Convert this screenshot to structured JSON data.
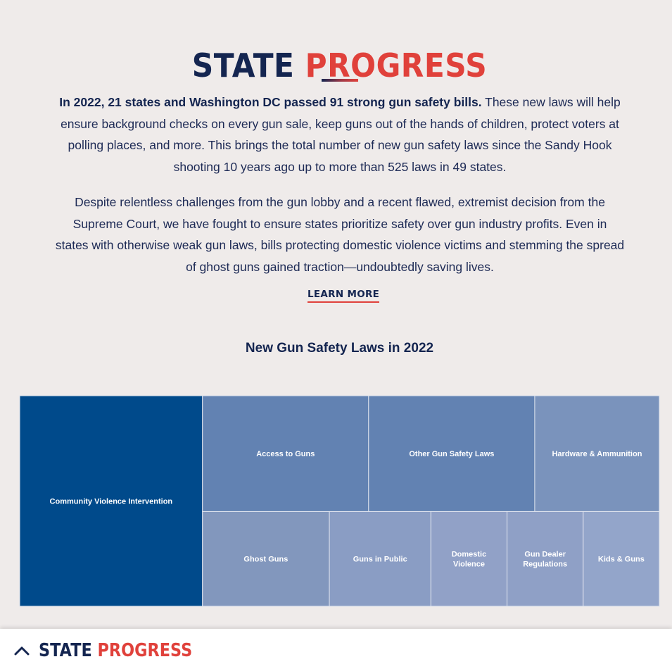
{
  "header": {
    "title_word1": "STATE",
    "title_word2": "PROGRESS"
  },
  "intro": {
    "bold_sentence": "In 2022, 21 states and Washington DC passed 91 strong gun safety bills.",
    "rest": " These new laws will help ensure background checks on every gun sale, keep guns out of the hands of children, protect voters at polling places, and more. This brings the total number of new gun safety laws since the Sandy Hook shooting 10 years ago up to more than 525 laws in 49 states.",
    "paragraph2": "Despite relentless challenges from the gun lobby and a recent flawed, extremist decision from the Supreme Court, we have fought to ensure states prioritize safety over gun industry profits. Even in states with otherwise weak gun laws, bills protecting domestic violence victims and stemming the spread of ghost guns gained traction—undoubtedly saving lives."
  },
  "learn_more_label": "LEARN MORE",
  "chart_data": {
    "type": "treemap",
    "title": "New Gun Safety Laws in 2022",
    "categories": [
      "Community Violence Intervention",
      "Access to Guns",
      "Other Gun Safety Laws",
      "Hardware & Ammunition",
      "Ghost Guns",
      "Guns in Public",
      "Domestic Violence",
      "Gun Dealer Regulations",
      "Kids & Guns"
    ],
    "values": [
      16,
      8,
      8,
      6,
      5,
      4,
      3,
      3,
      3
    ],
    "colors": [
      "#004a8b",
      "#6282b2",
      "#6282b2",
      "#7a93bc",
      "#8297bd",
      "#8a9dc4",
      "#91a1c7",
      "#8fa0c6",
      "#93a5ca"
    ]
  },
  "footer": {
    "title_word1": "STATE",
    "title_word2": "PROGRESS",
    "toggle_icon": "chevron-up-icon"
  }
}
